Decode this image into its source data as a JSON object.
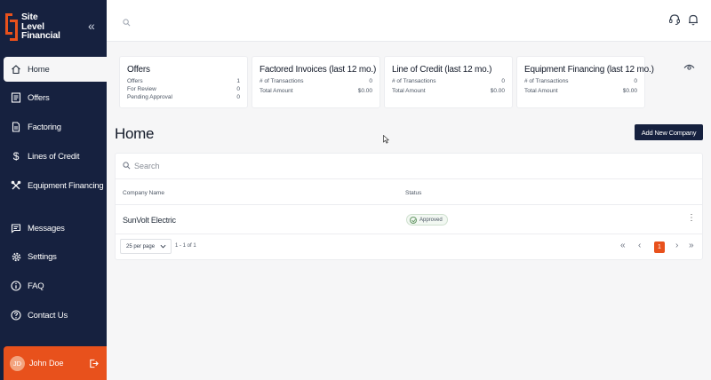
{
  "brand": {
    "line1": "Site",
    "line2": "Level",
    "line3": "Financial",
    "accent": "#e8511c",
    "navy": "#16213f"
  },
  "sidebar": {
    "items": [
      {
        "label": "Home",
        "icon": "home-icon"
      },
      {
        "label": "Offers",
        "icon": "offers-icon"
      },
      {
        "label": "Factoring",
        "icon": "document-icon"
      },
      {
        "label": "Lines of Credit",
        "icon": "dollar-icon"
      },
      {
        "label": "Equipment Financing",
        "icon": "tools-icon"
      },
      {
        "label": "Messages",
        "icon": "message-icon"
      },
      {
        "label": "Settings",
        "icon": "gear-icon"
      },
      {
        "label": "FAQ",
        "icon": "info-icon"
      },
      {
        "label": "Contact Us",
        "icon": "help-icon"
      }
    ]
  },
  "user": {
    "initials": "JD",
    "name": "John Doe"
  },
  "cards": [
    {
      "title": "Offers",
      "rows": [
        {
          "label": "Offers",
          "value": "1"
        },
        {
          "label": "For Review",
          "value": "0"
        },
        {
          "label": "Pending Approval",
          "value": "0"
        }
      ]
    },
    {
      "title": "Factored Invoices (last 12 mo.)",
      "rows": [
        {
          "label": "# of Transactions",
          "value": "0"
        },
        {
          "label": "Total Amount",
          "value": "$0.00"
        }
      ]
    },
    {
      "title": "Line of Credit (last 12 mo.)",
      "rows": [
        {
          "label": "# of Transactions",
          "value": "0"
        },
        {
          "label": "Total Amount",
          "value": "$0.00"
        }
      ]
    },
    {
      "title": "Equipment Financing (last 12 mo.)",
      "rows": [
        {
          "label": "# of Transactions",
          "value": "0"
        },
        {
          "label": "Total Amount",
          "value": "$0.00"
        }
      ]
    }
  ],
  "main": {
    "title": "Home",
    "add_button": "Add New Company"
  },
  "table": {
    "search_placeholder": "Search",
    "columns": [
      "Company Name",
      "Status"
    ],
    "rows": [
      {
        "company": "SunVolt Electric",
        "status": "Approved"
      }
    ],
    "per_page": "25 per page",
    "range": "1 - 1 of 1",
    "current_page": "1"
  }
}
